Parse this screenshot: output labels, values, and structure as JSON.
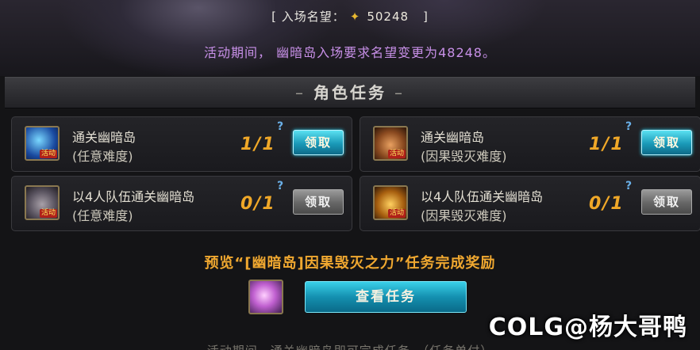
{
  "header": {
    "fame_prefix": "[ 入场名望：",
    "fame_icon": "fame-star-icon",
    "fame_value": "50248",
    "fame_suffix": "]",
    "notice": "活动期间， 幽暗岛入场要求名望变更为48248。"
  },
  "section": {
    "dash_left": "–",
    "title": "角色任务",
    "dash_right": "–"
  },
  "quests": [
    {
      "title": "通关幽暗岛",
      "sub": "(任意难度)",
      "progress": "1/1",
      "help": "?",
      "button": "领取",
      "button_state": "active",
      "badge": "活动"
    },
    {
      "title": "通关幽暗岛",
      "sub": "(因果毁灭难度)",
      "progress": "1/1",
      "help": "?",
      "button": "领取",
      "button_state": "active",
      "badge": "活动"
    },
    {
      "title": "以4人队伍通关幽暗岛",
      "sub": "(任意难度)",
      "progress": "0/1",
      "help": "?",
      "button": "领取",
      "button_state": "disabled",
      "badge": "活动"
    },
    {
      "title": "以4人队伍通关幽暗岛",
      "sub": "(因果毁灭难度)",
      "progress": "0/1",
      "help": "?",
      "button": "领取",
      "button_state": "disabled",
      "badge": "活动"
    }
  ],
  "preview": {
    "title": "预览“[幽暗岛]因果毁灭之力”任务完成奖励",
    "button": "查看任务"
  },
  "bottom_text": "活动期间，通关幽暗岛即可完成任务。（任务单付）",
  "watermark": "COLG@杨大哥鸭",
  "colors": {
    "accent_cyan": "#1a9ab8",
    "progress_orange": "#f0a828",
    "notice_purple": "#c890e8"
  }
}
